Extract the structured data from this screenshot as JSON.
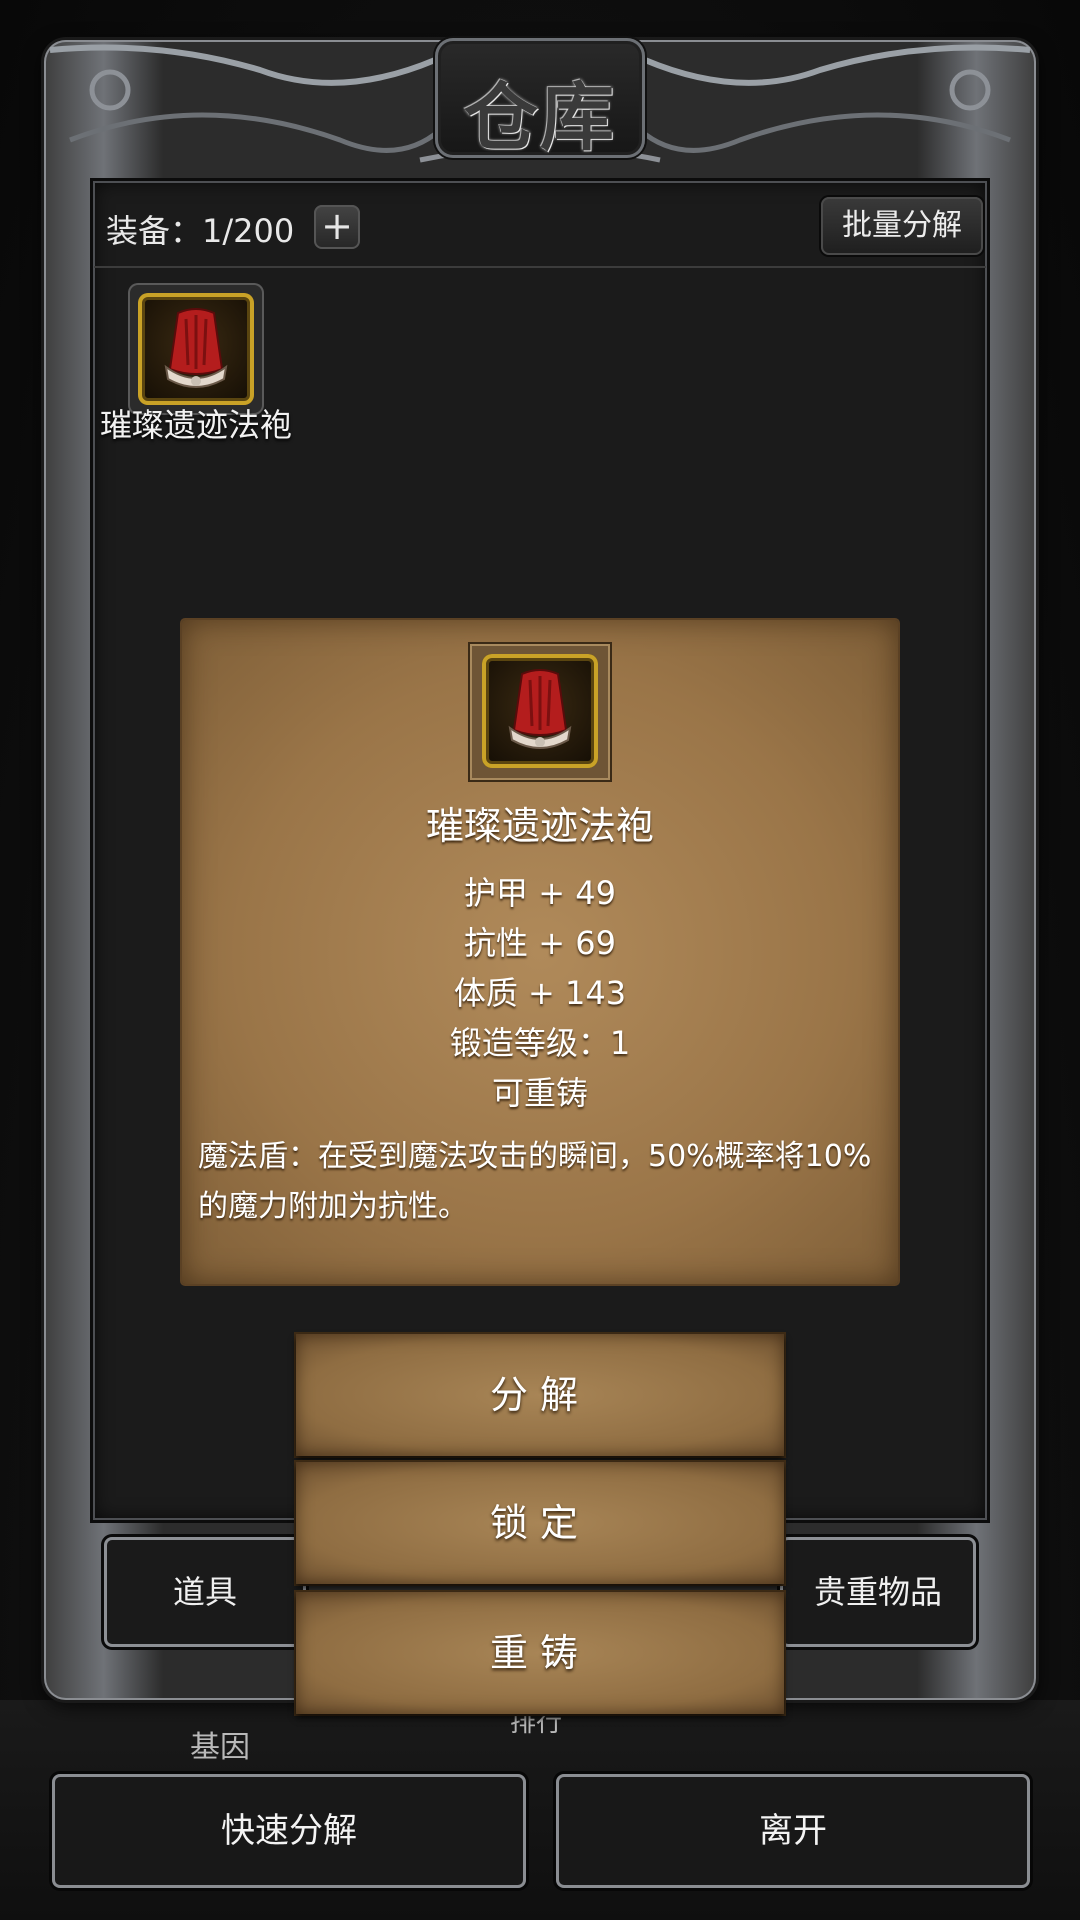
{
  "header": {
    "title": "仓库",
    "equip_count": "装备：1/200",
    "add_icon": "plus-icon",
    "batch_label": "批量分解"
  },
  "inventory": [
    {
      "name": "璀璨遗迹法袍",
      "icon": "red-robe-icon"
    }
  ],
  "tooltip": {
    "name": "璀璨遗迹法袍",
    "icon": "red-robe-icon",
    "stats": [
      "护甲 + 49",
      "抗性 + 69",
      "体质 + 143",
      "锻造等级：1",
      "可重铸"
    ],
    "description": "魔法盾：在受到魔法攻击的瞬间，50%概率将10%的魔力附加为抗性。"
  },
  "actions": {
    "decompose": "分解",
    "lock": "锁定",
    "reforge": "重铸"
  },
  "tabs": {
    "items": "道具",
    "valuables": "贵重物品"
  },
  "background_text": {
    "left": "基因",
    "center": "排行"
  },
  "bottom": {
    "quick_decompose": "快速分解",
    "leave": "离开"
  },
  "colors": {
    "gold_frame": "#c9a227",
    "parchment": "#9a7548",
    "robe_red": "#b41d1d"
  }
}
